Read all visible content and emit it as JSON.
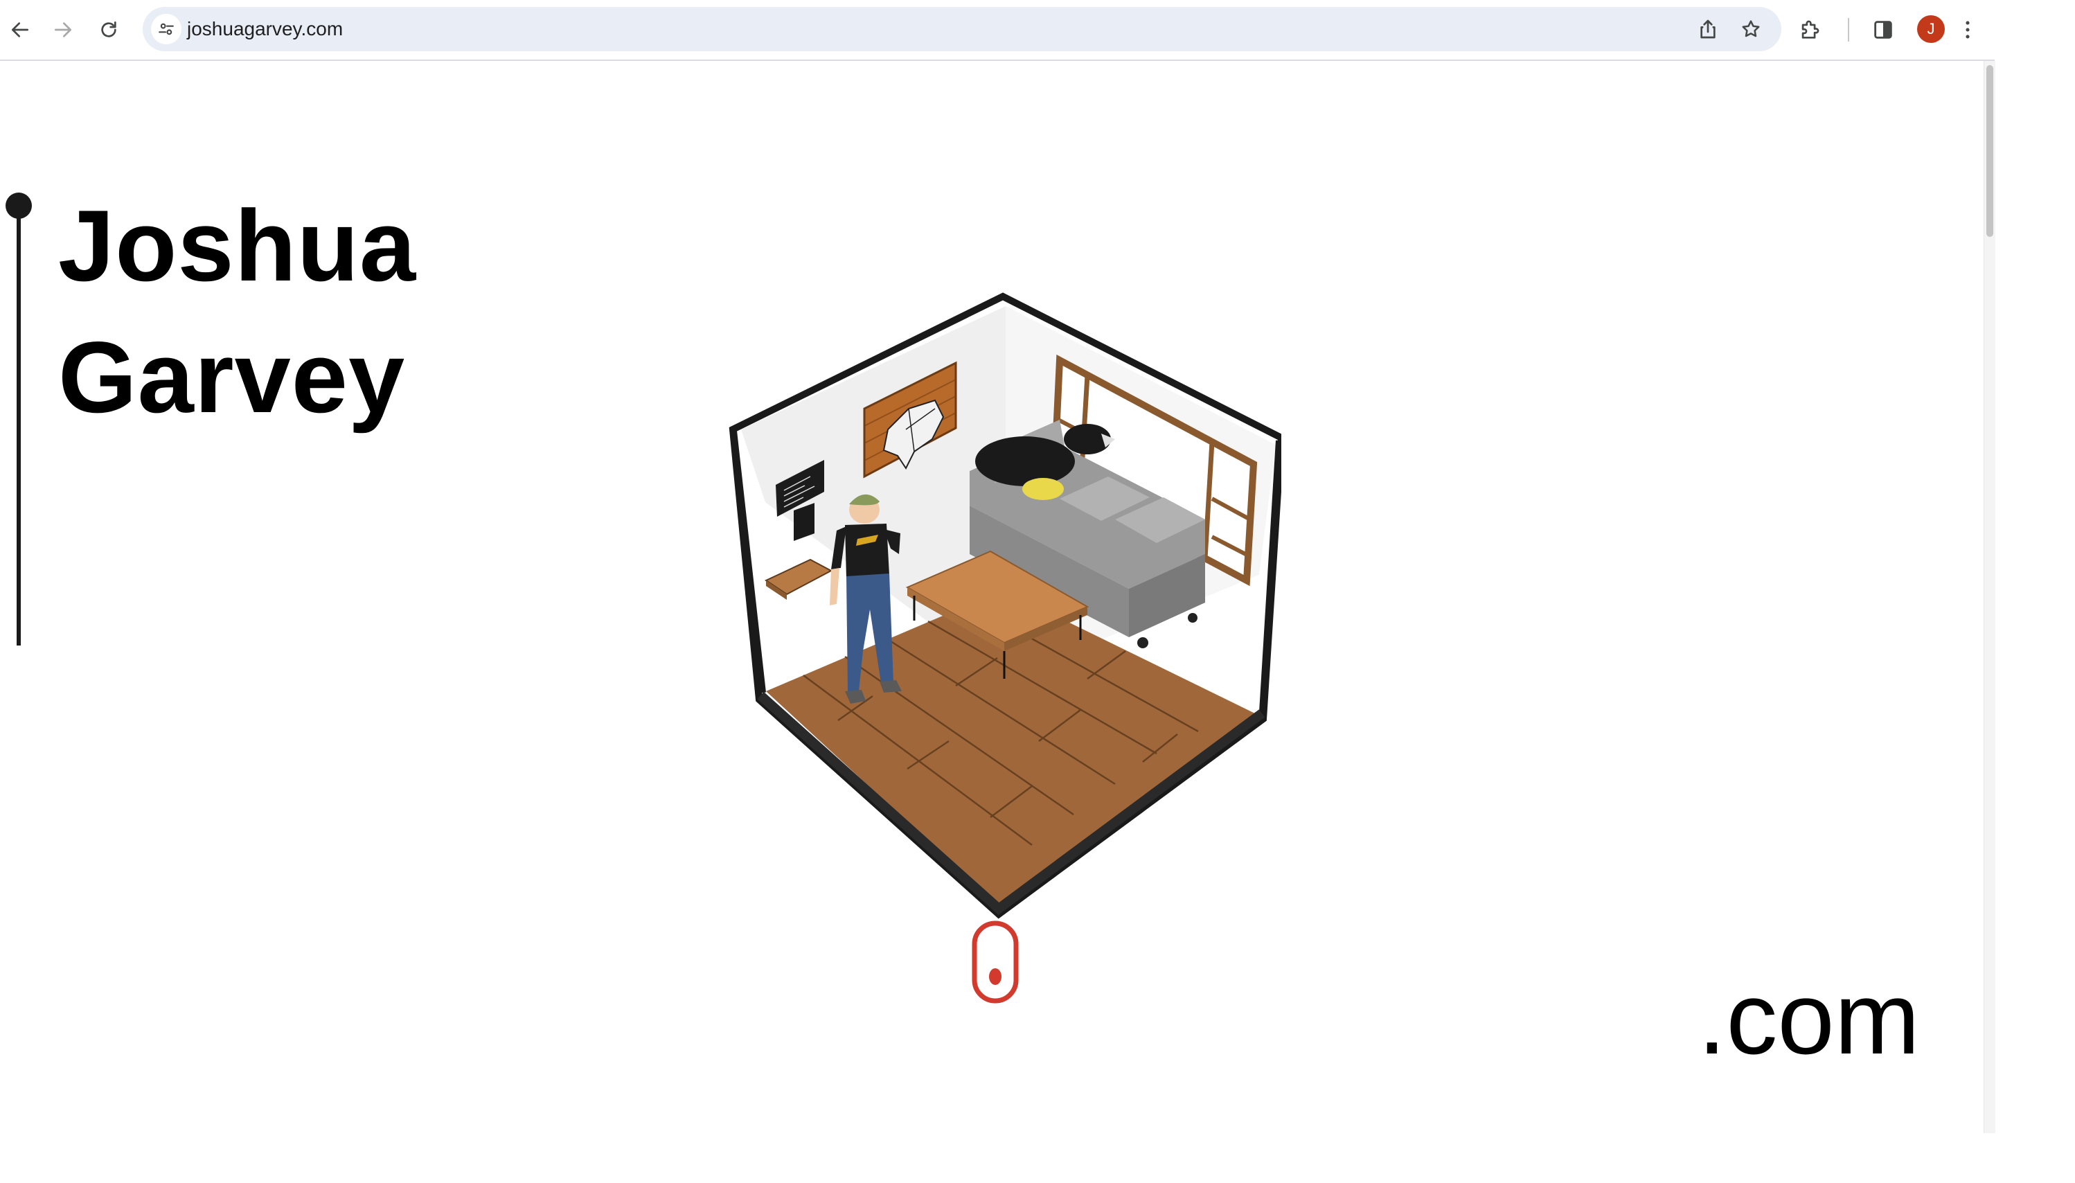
{
  "browser": {
    "url": "joshuagarvey.com",
    "profile_initial": "J",
    "icons": {
      "back": "back-arrow-icon",
      "forward": "forward-arrow-icon",
      "reload": "reload-icon",
      "site_info": "tune-icon",
      "share": "share-icon",
      "bookmark": "star-icon",
      "extensions": "puzzle-icon",
      "side_panel": "side-panel-icon",
      "menu": "kebab-menu-icon"
    },
    "colors": {
      "omnibox_bg": "#e8edf6",
      "avatar_bg": "#c33a1a"
    }
  },
  "page": {
    "name_first": "Joshua",
    "name_last": "Garvey",
    "domain_suffix": ".com",
    "illustration": "isometric-room-illustration",
    "scroll_indicator": "mouse-scroll-icon",
    "colors": {
      "accent": "#d23a2e",
      "text": "#000000",
      "timeline": "#1a1a1a"
    }
  }
}
